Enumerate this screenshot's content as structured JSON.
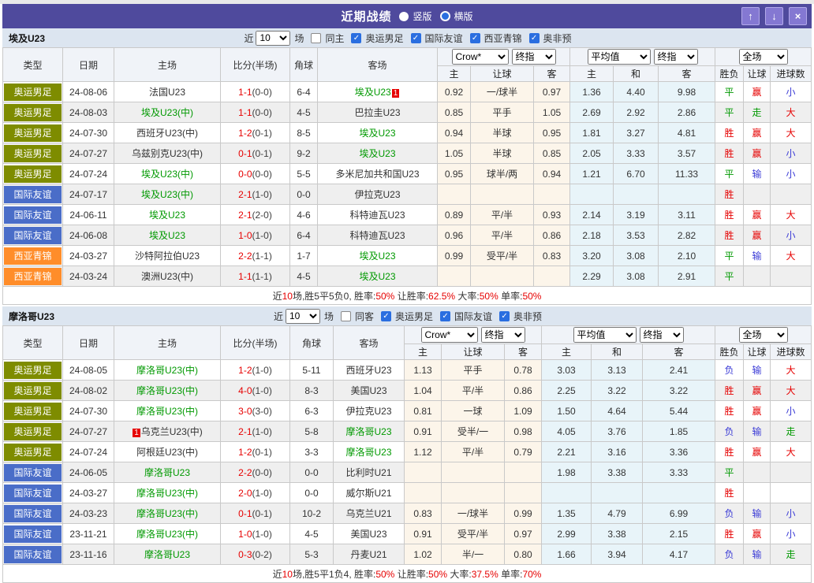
{
  "titlebar": {
    "title": "近期战绩",
    "radios": [
      {
        "label": "竖版",
        "selected": false
      },
      {
        "label": "横版",
        "selected": true
      }
    ],
    "buttons": [
      {
        "name": "up",
        "glyph": "↑"
      },
      {
        "name": "down",
        "glyph": "↓"
      },
      {
        "name": "close",
        "glyph": "×"
      }
    ]
  },
  "colors": {
    "accent_purple": "#4f4a9d",
    "type": {
      "奥运男足": "#7e8c00",
      "国际友谊": "#4a6dc8",
      "西亚青锦": "#ff8d2a"
    },
    "result": {
      "r": "#e60000",
      "g": "#009900",
      "b": "#3b3bd6"
    },
    "team_green": "#009900",
    "score_red": "#e60000"
  },
  "sections": [
    {
      "team": "埃及U23",
      "near_label": "近",
      "count": "10",
      "matches_label": "场",
      "same": {
        "label": "同主",
        "checked": false
      },
      "filters": [
        {
          "label": "奥运男足",
          "checked": true
        },
        {
          "label": "国际友谊",
          "checked": true
        },
        {
          "label": "西亚青锦",
          "checked": true
        },
        {
          "label": "奥非预",
          "checked": true
        }
      ],
      "table_head": {
        "base": [
          "类型",
          "日期",
          "主场",
          "比分(半场)",
          "角球",
          "客场"
        ],
        "groups": [
          {
            "selects": [
              "Crow*",
              "终指"
            ],
            "cols": [
              "主",
              "让球",
              "客"
            ]
          },
          {
            "selects": [
              "平均值",
              "终指"
            ],
            "cols": [
              "主",
              "和",
              "客"
            ]
          },
          {
            "selects": [
              "全场"
            ],
            "cols": [
              "胜负",
              "让球",
              "进球数"
            ]
          }
        ]
      },
      "rows": [
        {
          "type": "奥运男足",
          "date": "24-08-06",
          "home": {
            "name": "法国U23"
          },
          "score": {
            "ft": "1-1",
            "ht": "(0-0)"
          },
          "corner": "6-4",
          "away": {
            "name": "埃及U23",
            "green": true,
            "badge": "1"
          },
          "odds": [
            "0.92",
            "一/球半",
            "0.97"
          ],
          "avg": [
            "1.36",
            "4.40",
            "9.98"
          ],
          "results": [
            [
              "平",
              "g"
            ],
            [
              "赢",
              "r"
            ],
            [
              "小",
              "b"
            ]
          ]
        },
        {
          "type": "奥运男足",
          "date": "24-08-03",
          "home": {
            "name": "埃及U23(中)",
            "green": true
          },
          "score": {
            "ft": "1-1",
            "ht": "(0-0)"
          },
          "corner": "4-5",
          "away": {
            "name": "巴拉圭U23"
          },
          "odds": [
            "0.85",
            "平手",
            "1.05"
          ],
          "avg": [
            "2.69",
            "2.92",
            "2.86"
          ],
          "results": [
            [
              "平",
              "g"
            ],
            [
              "走",
              "g"
            ],
            [
              "大",
              "r"
            ]
          ]
        },
        {
          "type": "奥运男足",
          "date": "24-07-30",
          "home": {
            "name": "西班牙U23(中)"
          },
          "score": {
            "ft": "1-2",
            "ht": "(0-1)"
          },
          "corner": "8-5",
          "away": {
            "name": "埃及U23",
            "green": true
          },
          "odds": [
            "0.94",
            "半球",
            "0.95"
          ],
          "avg": [
            "1.81",
            "3.27",
            "4.81"
          ],
          "results": [
            [
              "胜",
              "r"
            ],
            [
              "赢",
              "r"
            ],
            [
              "大",
              "r"
            ]
          ]
        },
        {
          "type": "奥运男足",
          "date": "24-07-27",
          "home": {
            "name": "乌兹别克U23(中)"
          },
          "score": {
            "ft": "0-1",
            "ht": "(0-1)"
          },
          "corner": "9-2",
          "away": {
            "name": "埃及U23",
            "green": true
          },
          "odds": [
            "1.05",
            "半球",
            "0.85"
          ],
          "avg": [
            "2.05",
            "3.33",
            "3.57"
          ],
          "results": [
            [
              "胜",
              "r"
            ],
            [
              "赢",
              "r"
            ],
            [
              "小",
              "b"
            ]
          ]
        },
        {
          "type": "奥运男足",
          "date": "24-07-24",
          "home": {
            "name": "埃及U23(中)",
            "green": true
          },
          "score": {
            "ft": "0-0",
            "ht": "(0-0)"
          },
          "corner": "5-5",
          "away": {
            "name": "多米尼加共和国U23"
          },
          "odds": [
            "0.95",
            "球半/两",
            "0.94"
          ],
          "avg": [
            "1.21",
            "6.70",
            "11.33"
          ],
          "results": [
            [
              "平",
              "g"
            ],
            [
              "输",
              "b"
            ],
            [
              "小",
              "b"
            ]
          ]
        },
        {
          "type": "国际友谊",
          "date": "24-07-17",
          "home": {
            "name": "埃及U23(中)",
            "green": true
          },
          "score": {
            "ft": "2-1",
            "ht": "(1-0)"
          },
          "corner": "0-0",
          "away": {
            "name": "伊拉克U23"
          },
          "odds": [
            "",
            "",
            ""
          ],
          "avg": [
            "",
            "",
            ""
          ],
          "results": [
            [
              "胜",
              "r"
            ],
            [
              "",
              ""
            ],
            [
              "",
              ""
            ]
          ]
        },
        {
          "type": "国际友谊",
          "date": "24-06-11",
          "home": {
            "name": "埃及U23",
            "green": true
          },
          "score": {
            "ft": "2-1",
            "ht": "(2-0)"
          },
          "corner": "4-6",
          "away": {
            "name": "科特迪瓦U23"
          },
          "odds": [
            "0.89",
            "平/半",
            "0.93"
          ],
          "avg": [
            "2.14",
            "3.19",
            "3.11"
          ],
          "results": [
            [
              "胜",
              "r"
            ],
            [
              "赢",
              "r"
            ],
            [
              "大",
              "r"
            ]
          ]
        },
        {
          "type": "国际友谊",
          "date": "24-06-08",
          "home": {
            "name": "埃及U23",
            "green": true
          },
          "score": {
            "ft": "1-0",
            "ht": "(1-0)"
          },
          "corner": "6-4",
          "away": {
            "name": "科特迪瓦U23"
          },
          "odds": [
            "0.96",
            "平/半",
            "0.86"
          ],
          "avg": [
            "2.18",
            "3.53",
            "2.82"
          ],
          "results": [
            [
              "胜",
              "r"
            ],
            [
              "赢",
              "r"
            ],
            [
              "小",
              "b"
            ]
          ]
        },
        {
          "type": "西亚青锦",
          "date": "24-03-27",
          "home": {
            "name": "沙特阿拉伯U23"
          },
          "score": {
            "ft": "2-2",
            "ht": "(1-1)"
          },
          "corner": "1-7",
          "away": {
            "name": "埃及U23",
            "green": true
          },
          "odds": [
            "0.99",
            "受平/半",
            "0.83"
          ],
          "avg": [
            "3.20",
            "3.08",
            "2.10"
          ],
          "results": [
            [
              "平",
              "g"
            ],
            [
              "输",
              "b"
            ],
            [
              "大",
              "r"
            ]
          ]
        },
        {
          "type": "西亚青锦",
          "date": "24-03-24",
          "home": {
            "name": "澳洲U23(中)"
          },
          "score": {
            "ft": "1-1",
            "ht": "(1-1)"
          },
          "corner": "4-5",
          "away": {
            "name": "埃及U23",
            "green": true
          },
          "odds": [
            "",
            "",
            ""
          ],
          "avg": [
            "2.29",
            "3.08",
            "2.91"
          ],
          "results": [
            [
              "平",
              "g"
            ],
            [
              "",
              ""
            ],
            [
              "",
              ""
            ]
          ]
        }
      ],
      "summary": [
        {
          "text": "近",
          "red": false
        },
        {
          "text": "10",
          "red": true
        },
        {
          "text": "场,胜5平5负0, 胜率:",
          "red": false
        },
        {
          "text": "50%",
          "red": true
        },
        {
          "text": " 让胜率:",
          "red": false
        },
        {
          "text": "62.5%",
          "red": true
        },
        {
          "text": " 大率:",
          "red": false
        },
        {
          "text": "50%",
          "red": true
        },
        {
          "text": " 单率:",
          "red": false
        },
        {
          "text": "50%",
          "red": true
        }
      ]
    },
    {
      "team": "摩洛哥U23",
      "near_label": "近",
      "count": "10",
      "matches_label": "场",
      "same": {
        "label": "同客",
        "checked": false
      },
      "filters": [
        {
          "label": "奥运男足",
          "checked": true
        },
        {
          "label": "国际友谊",
          "checked": true
        },
        {
          "label": "奥非预",
          "checked": true
        }
      ],
      "table_head": {
        "base": [
          "类型",
          "日期",
          "主场",
          "比分(半场)",
          "角球",
          "客场"
        ],
        "groups": [
          {
            "selects": [
              "Crow*",
              "终指"
            ],
            "cols": [
              "主",
              "让球",
              "客"
            ]
          },
          {
            "selects": [
              "平均值",
              "终指"
            ],
            "cols": [
              "主",
              "和",
              "客"
            ]
          },
          {
            "selects": [
              "全场"
            ],
            "cols": [
              "胜负",
              "让球",
              "进球数"
            ]
          }
        ]
      },
      "rows": [
        {
          "type": "奥运男足",
          "date": "24-08-05",
          "home": {
            "name": "摩洛哥U23(中)",
            "green": true
          },
          "score": {
            "ft": "1-2",
            "ht": "(1-0)"
          },
          "corner": "5-11",
          "away": {
            "name": "西班牙U23"
          },
          "odds": [
            "1.13",
            "平手",
            "0.78"
          ],
          "avg": [
            "3.03",
            "3.13",
            "2.41"
          ],
          "results": [
            [
              "负",
              "b"
            ],
            [
              "输",
              "b"
            ],
            [
              "大",
              "r"
            ]
          ]
        },
        {
          "type": "奥运男足",
          "date": "24-08-02",
          "home": {
            "name": "摩洛哥U23(中)",
            "green": true
          },
          "score": {
            "ft": "4-0",
            "ht": "(1-0)"
          },
          "corner": "8-3",
          "away": {
            "name": "美国U23"
          },
          "odds": [
            "1.04",
            "平/半",
            "0.86"
          ],
          "avg": [
            "2.25",
            "3.22",
            "3.22"
          ],
          "results": [
            [
              "胜",
              "r"
            ],
            [
              "赢",
              "r"
            ],
            [
              "大",
              "r"
            ]
          ]
        },
        {
          "type": "奥运男足",
          "date": "24-07-30",
          "home": {
            "name": "摩洛哥U23(中)",
            "green": true
          },
          "score": {
            "ft": "3-0",
            "ht": "(3-0)"
          },
          "corner": "6-3",
          "away": {
            "name": "伊拉克U23"
          },
          "odds": [
            "0.81",
            "一球",
            "1.09"
          ],
          "avg": [
            "1.50",
            "4.64",
            "5.44"
          ],
          "results": [
            [
              "胜",
              "r"
            ],
            [
              "赢",
              "r"
            ],
            [
              "小",
              "b"
            ]
          ]
        },
        {
          "type": "奥运男足",
          "date": "24-07-27",
          "home": {
            "name": "乌克兰U23(中)",
            "badge": "1",
            "badge_before": true
          },
          "score": {
            "ft": "2-1",
            "ht": "(1-0)"
          },
          "corner": "5-8",
          "away": {
            "name": "摩洛哥U23",
            "green": true
          },
          "odds": [
            "0.91",
            "受半/一",
            "0.98"
          ],
          "avg": [
            "4.05",
            "3.76",
            "1.85"
          ],
          "results": [
            [
              "负",
              "b"
            ],
            [
              "输",
              "b"
            ],
            [
              "走",
              "g"
            ]
          ]
        },
        {
          "type": "奥运男足",
          "date": "24-07-24",
          "home": {
            "name": "阿根廷U23(中)"
          },
          "score": {
            "ft": "1-2",
            "ht": "(0-1)"
          },
          "corner": "3-3",
          "away": {
            "name": "摩洛哥U23",
            "green": true
          },
          "odds": [
            "1.12",
            "平/半",
            "0.79"
          ],
          "avg": [
            "2.21",
            "3.16",
            "3.36"
          ],
          "results": [
            [
              "胜",
              "r"
            ],
            [
              "赢",
              "r"
            ],
            [
              "大",
              "r"
            ]
          ]
        },
        {
          "type": "国际友谊",
          "date": "24-06-05",
          "home": {
            "name": "摩洛哥U23",
            "green": true
          },
          "score": {
            "ft": "2-2",
            "ht": "(0-0)"
          },
          "corner": "0-0",
          "away": {
            "name": "比利时U21"
          },
          "odds": [
            "",
            "",
            ""
          ],
          "avg": [
            "1.98",
            "3.38",
            "3.33"
          ],
          "results": [
            [
              "平",
              "g"
            ],
            [
              "",
              ""
            ],
            [
              "",
              ""
            ]
          ]
        },
        {
          "type": "国际友谊",
          "date": "24-03-27",
          "home": {
            "name": "摩洛哥U23(中)",
            "green": true
          },
          "score": {
            "ft": "2-0",
            "ht": "(1-0)"
          },
          "corner": "0-0",
          "away": {
            "name": "威尔斯U21"
          },
          "odds": [
            "",
            "",
            ""
          ],
          "avg": [
            "",
            "",
            ""
          ],
          "results": [
            [
              "胜",
              "r"
            ],
            [
              "",
              ""
            ],
            [
              "",
              ""
            ]
          ]
        },
        {
          "type": "国际友谊",
          "date": "24-03-23",
          "home": {
            "name": "摩洛哥U23(中)",
            "green": true
          },
          "score": {
            "ft": "0-1",
            "ht": "(0-1)"
          },
          "corner": "10-2",
          "away": {
            "name": "乌克兰U21"
          },
          "odds": [
            "0.83",
            "一/球半",
            "0.99"
          ],
          "avg": [
            "1.35",
            "4.79",
            "6.99"
          ],
          "results": [
            [
              "负",
              "b"
            ],
            [
              "输",
              "b"
            ],
            [
              "小",
              "b"
            ]
          ]
        },
        {
          "type": "国际友谊",
          "date": "23-11-21",
          "home": {
            "name": "摩洛哥U23(中)",
            "green": true
          },
          "score": {
            "ft": "1-0",
            "ht": "(1-0)"
          },
          "corner": "4-5",
          "away": {
            "name": "美国U23"
          },
          "odds": [
            "0.91",
            "受平/半",
            "0.97"
          ],
          "avg": [
            "2.99",
            "3.38",
            "2.15"
          ],
          "results": [
            [
              "胜",
              "r"
            ],
            [
              "赢",
              "r"
            ],
            [
              "小",
              "b"
            ]
          ]
        },
        {
          "type": "国际友谊",
          "date": "23-11-16",
          "home": {
            "name": "摩洛哥U23",
            "green": true
          },
          "score": {
            "ft": "0-3",
            "ht": "(0-2)"
          },
          "corner": "5-3",
          "away": {
            "name": "丹麦U21"
          },
          "odds": [
            "1.02",
            "半/一",
            "0.80"
          ],
          "avg": [
            "1.66",
            "3.94",
            "4.17"
          ],
          "results": [
            [
              "负",
              "b"
            ],
            [
              "输",
              "b"
            ],
            [
              "走",
              "g"
            ]
          ]
        }
      ],
      "summary": [
        {
          "text": "近",
          "red": false
        },
        {
          "text": "10",
          "red": true
        },
        {
          "text": "场,胜5平1负4, 胜率:",
          "red": false
        },
        {
          "text": "50%",
          "red": true
        },
        {
          "text": " 让胜率:",
          "red": false
        },
        {
          "text": "50%",
          "red": true
        },
        {
          "text": " 大率:",
          "red": false
        },
        {
          "text": "37.5%",
          "red": true
        },
        {
          "text": " 单率:",
          "red": false
        },
        {
          "text": "70%",
          "red": true
        }
      ]
    }
  ]
}
